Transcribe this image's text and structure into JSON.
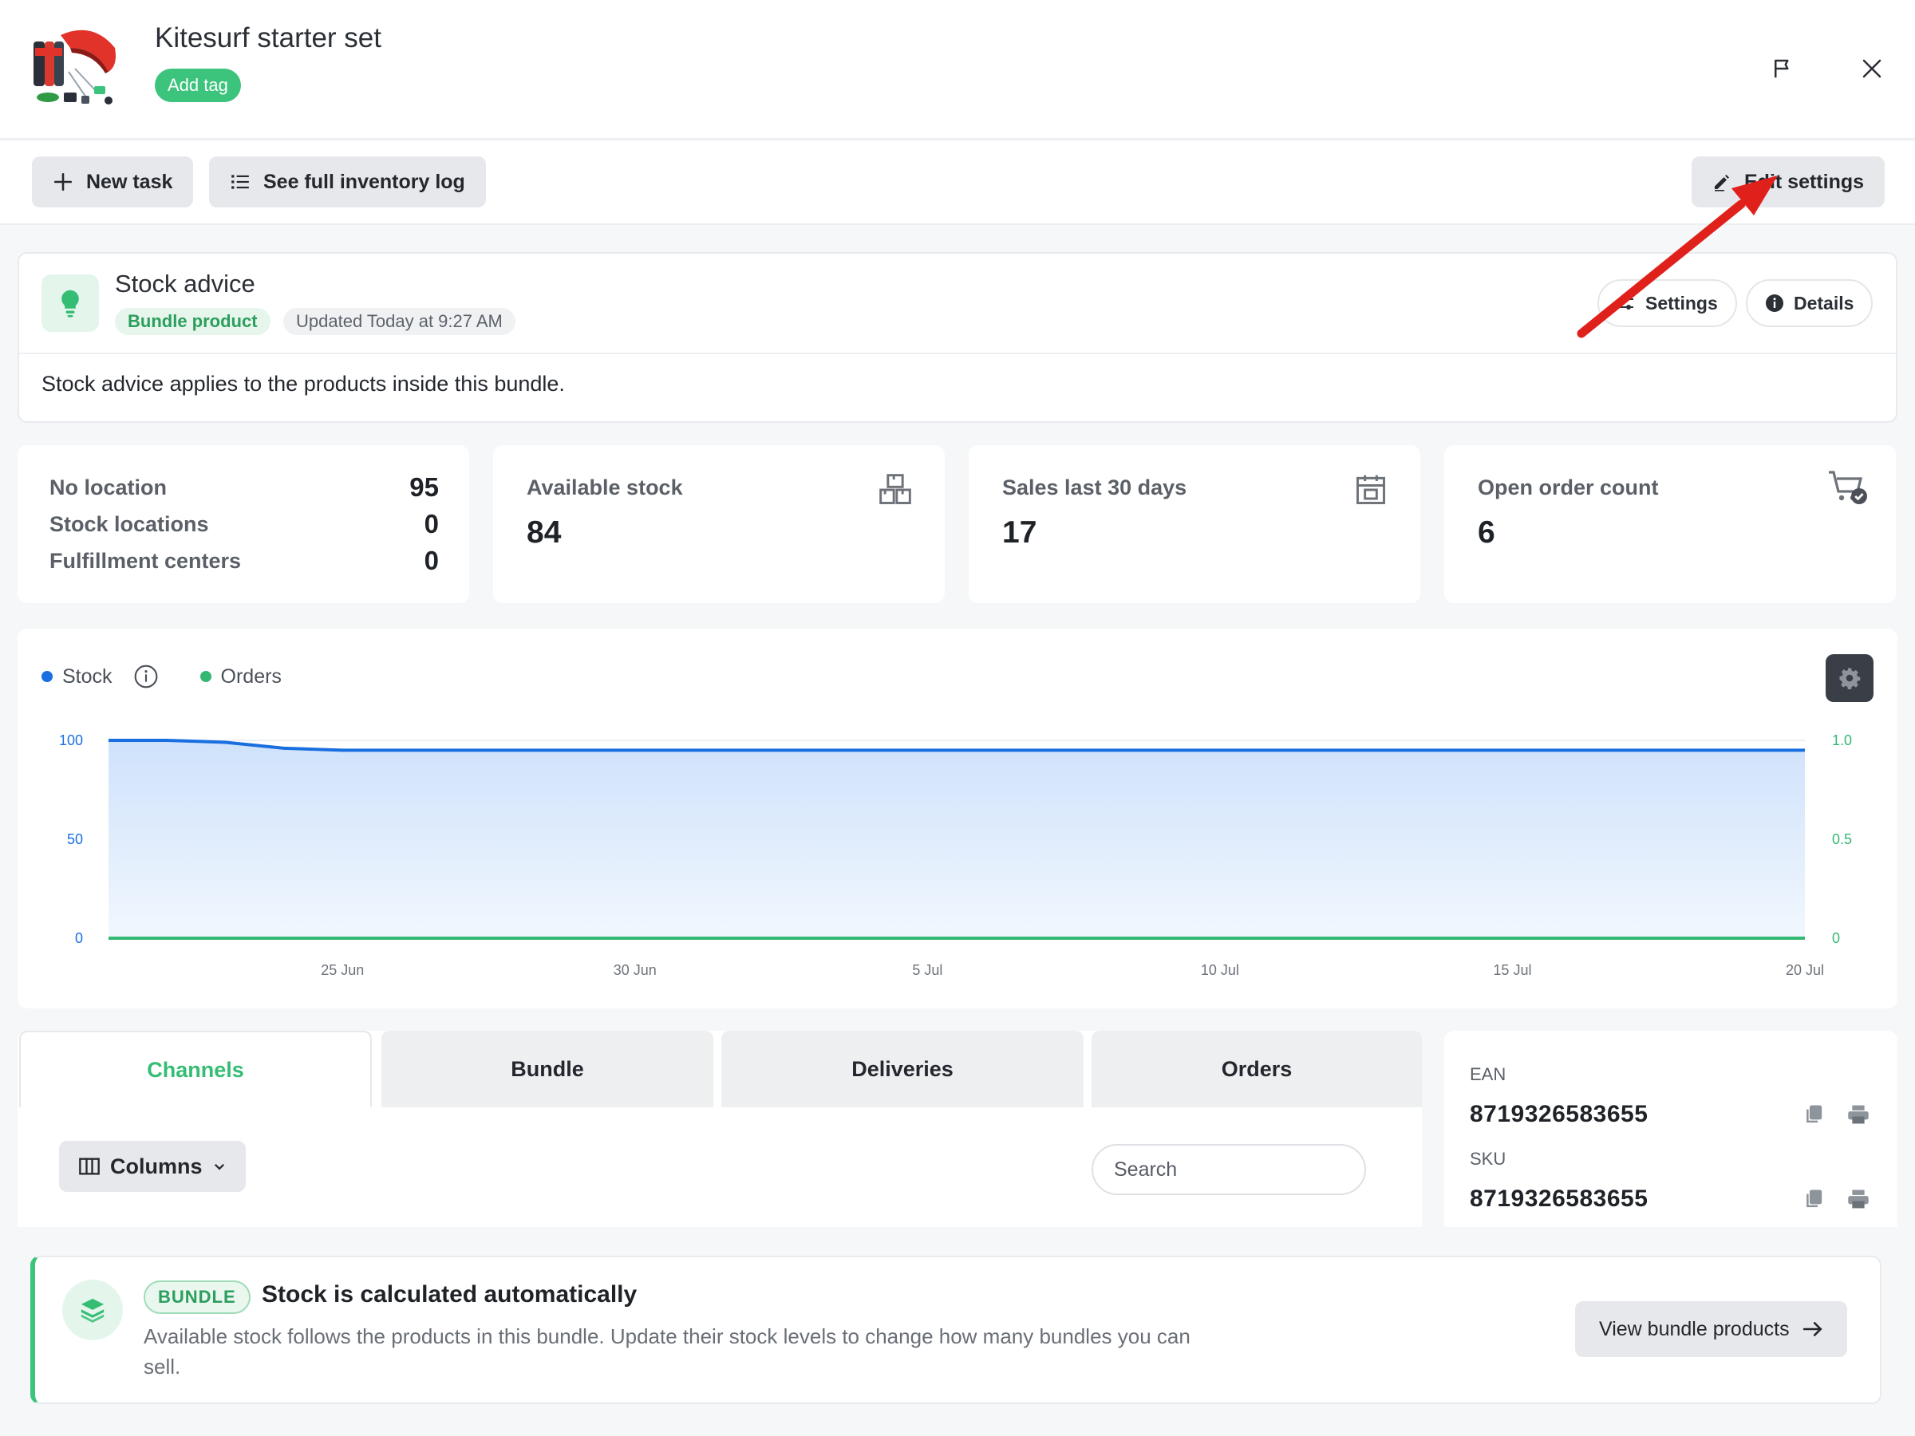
{
  "header": {
    "product_title": "Kitesurf starter set",
    "add_tag_label": "Add tag"
  },
  "toolbar": {
    "new_task_label": "New task",
    "inventory_log_label": "See full inventory log",
    "edit_settings_label": "Edit settings"
  },
  "stock_advice": {
    "title": "Stock advice",
    "badge": "Bundle product",
    "updated": "Updated Today at 9:27 AM",
    "settings_label": "Settings",
    "details_label": "Details",
    "text": "Stock advice applies to the products inside this bundle."
  },
  "locations": [
    {
      "label": "No location",
      "value": "95"
    },
    {
      "label": "Stock locations",
      "value": "0"
    },
    {
      "label": "Fulfillment centers",
      "value": "0"
    }
  ],
  "stats": [
    {
      "label": "Available stock",
      "value": "84",
      "icon": "boxes-icon"
    },
    {
      "label": "Sales last 30 days",
      "value": "17",
      "icon": "calendar-icon"
    },
    {
      "label": "Open order count",
      "value": "6",
      "icon": "cart-check-icon"
    }
  ],
  "chart_data": {
    "type": "area",
    "series": [
      {
        "name": "Stock",
        "color": "#1a6fe0",
        "axis": "left",
        "x": [
          "2024-06-21",
          "2024-06-22",
          "2024-06-23",
          "2024-06-24",
          "2024-06-25",
          "2024-06-30",
          "2024-07-05",
          "2024-07-10",
          "2024-07-15",
          "2024-07-20"
        ],
        "values": [
          100,
          100,
          99,
          96,
          95,
          95,
          95,
          95,
          95,
          95
        ]
      },
      {
        "name": "Orders",
        "color": "#33b872",
        "axis": "right",
        "x": [
          "2024-06-21",
          "2024-07-20"
        ],
        "values": [
          0,
          0
        ]
      }
    ],
    "x_range": [
      "2024-06-21",
      "2024-07-20"
    ],
    "x_ticks": [
      "25 Jun",
      "30 Jun",
      "5 Jul",
      "10 Jul",
      "15 Jul",
      "20 Jul"
    ],
    "y_left": {
      "range": [
        0,
        100
      ],
      "ticks": [
        "100",
        "50",
        "0"
      ]
    },
    "y_right": {
      "range": [
        0,
        1
      ],
      "ticks": [
        "1.0",
        "0.5",
        "0"
      ]
    },
    "legend_position": "top-left",
    "grid": true
  },
  "tabs": [
    {
      "label": "Channels",
      "active": true
    },
    {
      "label": "Bundle",
      "active": false
    },
    {
      "label": "Deliveries",
      "active": false
    },
    {
      "label": "Orders",
      "active": false
    }
  ],
  "table_tools": {
    "columns_label": "Columns",
    "search_placeholder": "Search"
  },
  "codes": {
    "ean_label": "EAN",
    "ean_value": "8719326583655",
    "sku_label": "SKU",
    "sku_value": "8719326583655"
  },
  "banner": {
    "pill": "BUNDLE",
    "title": "Stock is calculated automatically",
    "text": "Available stock follows the products in this bundle. Update their stock levels to change how many bundles you can sell.",
    "button_label": "View bundle products"
  },
  "colors": {
    "accent_green": "#3cc47c",
    "stock_blue": "#1a6fe0",
    "annotation_red": "#e0201b"
  }
}
